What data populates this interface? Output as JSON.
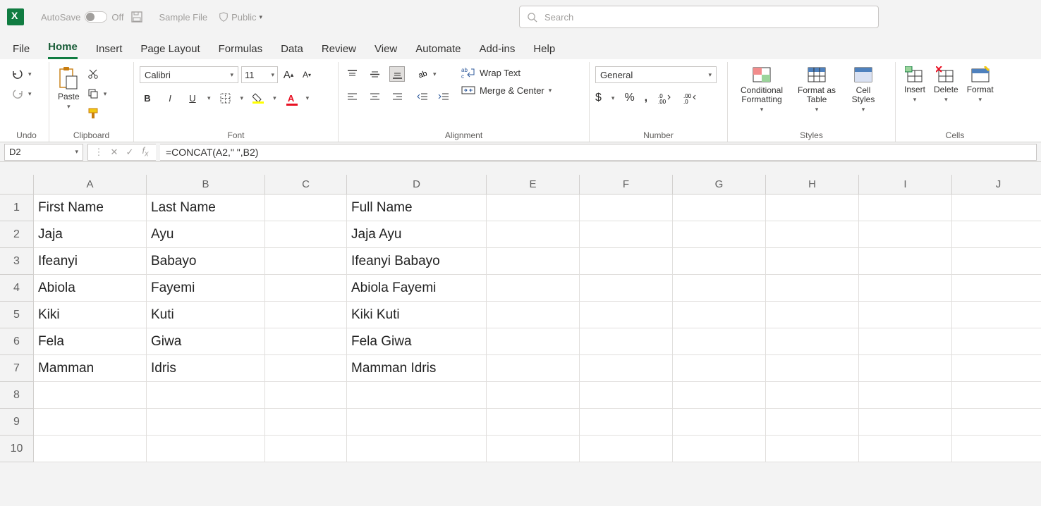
{
  "titlebar": {
    "autosave_label": "AutoSave",
    "autosave_state": "Off",
    "filename": "Sample File",
    "privacy_label": "Public",
    "search_placeholder": "Search"
  },
  "tabs": {
    "file": "File",
    "home": "Home",
    "insert": "Insert",
    "page_layout": "Page Layout",
    "formulas": "Formulas",
    "data": "Data",
    "review": "Review",
    "view": "View",
    "automate": "Automate",
    "addins": "Add-ins",
    "help": "Help"
  },
  "ribbon": {
    "undo": {
      "label": "Undo"
    },
    "clipboard": {
      "paste": "Paste",
      "label": "Clipboard"
    },
    "font": {
      "name": "Calibri",
      "size": "11",
      "label": "Font"
    },
    "alignment": {
      "wrap": "Wrap Text",
      "merge": "Merge & Center",
      "label": "Alignment"
    },
    "number": {
      "format": "General",
      "label": "Number"
    },
    "styles": {
      "cond": "Conditional Formatting",
      "table": "Format as Table",
      "cell": "Cell Styles",
      "label": "Styles"
    },
    "cells": {
      "insert": "Insert",
      "delete": "Delete",
      "format": "Format",
      "label": "Cells"
    }
  },
  "formula_bar": {
    "namebox": "D2",
    "formula": "=CONCAT(A2,\" \",B2)"
  },
  "grid": {
    "columns": [
      "A",
      "B",
      "C",
      "D",
      "E",
      "F",
      "G",
      "H",
      "I",
      "J"
    ],
    "rows": [
      "1",
      "2",
      "3",
      "4",
      "5",
      "6",
      "7",
      "8",
      "9",
      "10"
    ],
    "data": [
      {
        "A": "First Name",
        "B": "Last Name",
        "C": "",
        "D": "Full Name"
      },
      {
        "A": "Jaja",
        "B": "Ayu",
        "C": "",
        "D": "Jaja Ayu"
      },
      {
        "A": "Ifeanyi",
        "B": "Babayo",
        "C": "",
        "D": "Ifeanyi Babayo"
      },
      {
        "A": "Abiola",
        "B": "Fayemi",
        "C": "",
        "D": "Abiola Fayemi"
      },
      {
        "A": "Kiki",
        "B": "Kuti",
        "C": "",
        "D": "Kiki Kuti"
      },
      {
        "A": "Fela",
        "B": "Giwa",
        "C": "",
        "D": "Fela Giwa"
      },
      {
        "A": "Mamman",
        "B": "Idris",
        "C": "",
        "D": "Mamman Idris"
      },
      {
        "A": "",
        "B": "",
        "C": "",
        "D": ""
      },
      {
        "A": "",
        "B": "",
        "C": "",
        "D": ""
      },
      {
        "A": "",
        "B": "",
        "C": "",
        "D": ""
      }
    ]
  }
}
